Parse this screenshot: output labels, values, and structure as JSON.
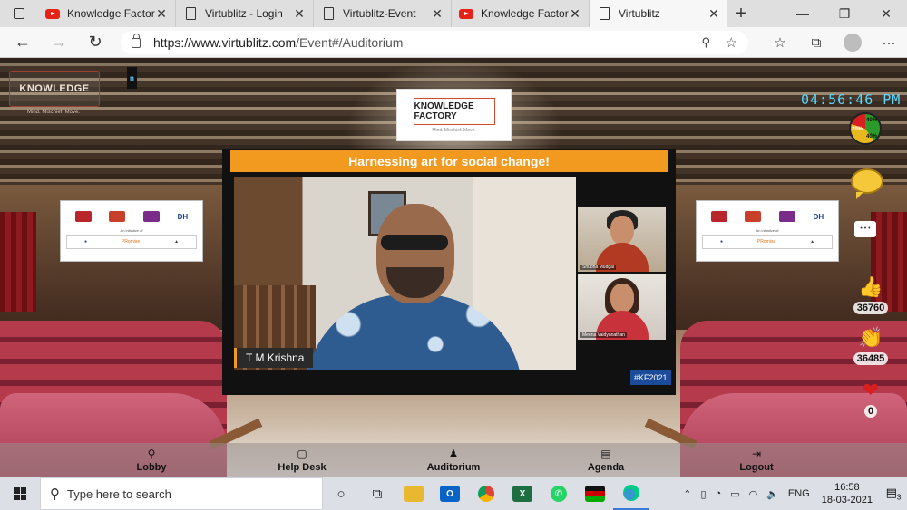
{
  "browser": {
    "tabs": [
      {
        "label": "Knowledge Factory",
        "icon": "youtube-icon"
      },
      {
        "label": "Virtublitz - Login",
        "icon": "page-icon"
      },
      {
        "label": "Virtublitz-Event",
        "icon": "page-icon"
      },
      {
        "label": "Knowledge Factory",
        "icon": "youtube-icon"
      },
      {
        "label": "Virtublitz",
        "icon": "page-icon",
        "active": true
      }
    ],
    "url_host": "https://www.virtublitz.com",
    "url_path": "/Event#/Auditorium"
  },
  "event": {
    "logo_text": "KNOWLEDGE",
    "logo_tagline": "Mind. Mischief. Move.",
    "chip_text": "n",
    "center_logo_text": "KNOWLEDGE FACTORY",
    "center_logo_tagline": "Mind. Mischief. Move.",
    "clock": "04:56:46 PM",
    "gauge": {
      "green": "40%",
      "red": "20%",
      "yellow": "40%"
    },
    "session_title": "Harnessing art for social change!",
    "speaker": "T M Krishna",
    "panelists": [
      "Shubha Mudgal",
      "Meena Vaidyanathan"
    ],
    "hashtag": "#KF2021",
    "sponsor": {
      "initiative": "An initiative of",
      "top": [
        "",
        "",
        "",
        "DH"
      ],
      "bottom": [
        "",
        "PRomise",
        ""
      ]
    }
  },
  "reactions": {
    "chat_label": "",
    "like_count": "36760",
    "clap_count": "36485",
    "heart_count": "0"
  },
  "nav": {
    "lobby": "Lobby",
    "help_desk": "Help Desk",
    "auditorium": "Auditorium",
    "agenda": "Agenda",
    "logout": "Logout"
  },
  "taskbar": {
    "search_placeholder": "Type here to search",
    "lang": "ENG",
    "time": "16:58",
    "date": "18-03-2021",
    "notifications": "3"
  },
  "colors": {
    "title_bar": "#f29a20",
    "clock": "#5ad6ff",
    "hashtag_bg": "#1c4b9a"
  }
}
